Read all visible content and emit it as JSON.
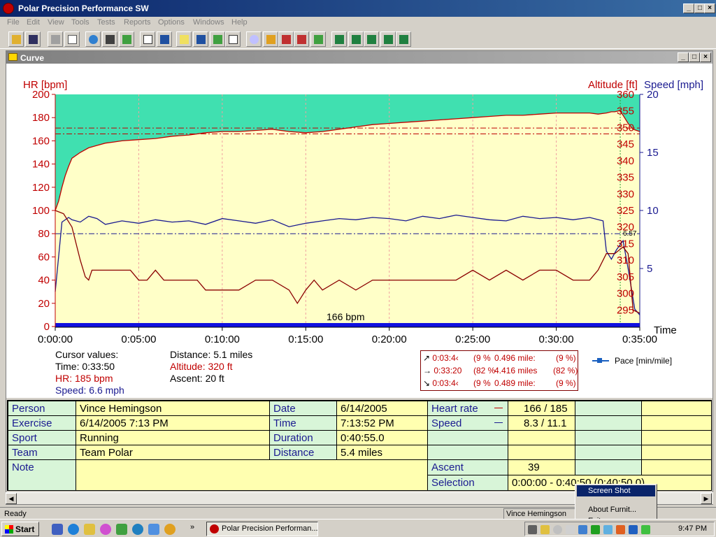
{
  "app": {
    "title": "Polar Precision Performance SW",
    "menu": [
      "File",
      "Edit",
      "View",
      "Tools",
      "Tests",
      "Reports",
      "Options",
      "Windows",
      "Help"
    ]
  },
  "child_window": {
    "title": "Curve"
  },
  "chart_data": {
    "type": "line",
    "xlabel": "Time",
    "x_ticks": [
      "0:00:00",
      "0:05:00",
      "0:10:00",
      "0:15:00",
      "0:20:00",
      "0:25:00",
      "0:30:00",
      "0:35:00"
    ],
    "xlim_minutes": [
      0,
      35
    ],
    "axes": {
      "left": {
        "label": "HR [bpm]",
        "color": "#c00000",
        "ylim": [
          0,
          200
        ],
        "ticks": [
          "0",
          "20",
          "40",
          "60",
          "80",
          "100",
          "120",
          "140",
          "160",
          "180",
          "200"
        ]
      },
      "right_altitude": {
        "label": "Altitude [ft]",
        "color": "#c00000",
        "ylim": [
          290,
          360
        ],
        "ticks": [
          "295",
          "300",
          "305",
          "310",
          "315",
          "320",
          "325",
          "330",
          "335",
          "340",
          "345",
          "350",
          "355",
          "360"
        ]
      },
      "right_speed": {
        "label": "Speed [mph]",
        "color": "#1a1a90",
        "ylim": [
          0,
          20
        ],
        "ticks": [
          "5",
          "10",
          "15",
          "20"
        ]
      }
    },
    "annotation": "166 bpm",
    "cursor_readout": "6.57",
    "reference_lines_hr": [
      166,
      171
    ],
    "reference_line_speed": 8,
    "cursor_minutes": 33.83,
    "series": [
      {
        "name": "HR",
        "axis": "left",
        "color": "#c00000",
        "x": [
          0,
          0.2,
          0.4,
          0.6,
          0.8,
          1,
          1.5,
          2,
          2.5,
          3,
          3.5,
          4,
          5,
          6,
          7,
          8,
          9,
          10,
          11,
          12,
          13,
          14,
          15,
          16,
          17,
          18,
          19,
          20,
          21,
          22,
          23,
          24,
          25,
          26,
          27,
          28,
          29,
          30,
          31,
          32,
          32.5,
          33,
          33.3,
          33.5,
          33.8,
          34,
          34.3,
          34.6,
          35
        ],
        "y": [
          100,
          108,
          120,
          130,
          138,
          145,
          150,
          154,
          156,
          158,
          159,
          160,
          161,
          162,
          164,
          165,
          167,
          168,
          168,
          169,
          170,
          168,
          167,
          168,
          170,
          172,
          174,
          175,
          176,
          177,
          178,
          179,
          180,
          181,
          182,
          182,
          183,
          184,
          184,
          184,
          183,
          184,
          185,
          185,
          186,
          182,
          175,
          170,
          168
        ]
      },
      {
        "name": "Speed",
        "axis": "right_speed",
        "color": "#1a1a90",
        "x": [
          0,
          0.2,
          0.4,
          0.8,
          1,
          1.5,
          2,
          2.5,
          3,
          4,
          5,
          6,
          7,
          8,
          9,
          10,
          11,
          12,
          13,
          14,
          15,
          16,
          17,
          18,
          19,
          20,
          21,
          22,
          23,
          24,
          25,
          26,
          27,
          28,
          29,
          30,
          31,
          32,
          32.8,
          33,
          33.3,
          33.6,
          34,
          34.3,
          34.7,
          35
        ],
        "y": [
          3,
          6,
          9,
          9.4,
          9.2,
          9,
          9.5,
          9.3,
          8.8,
          9.1,
          8.9,
          9.2,
          9,
          9.1,
          8.8,
          9.3,
          9.1,
          8.9,
          9.2,
          8.6,
          8.9,
          9.1,
          9.3,
          9.2,
          9.4,
          9.3,
          9.1,
          9.5,
          9.3,
          9.6,
          9.4,
          9.2,
          9.1,
          9.5,
          9.3,
          9.4,
          9.2,
          9.4,
          9.1,
          6.5,
          5.8,
          6.6,
          7.4,
          5,
          1.5,
          1
        ]
      },
      {
        "name": "Altitude",
        "axis": "right_altitude",
        "color": "#8b0000",
        "x": [
          0,
          0.5,
          1,
          1.5,
          1.8,
          2,
          2.2,
          2.5,
          4.5,
          5,
          5.5,
          6,
          6.5,
          8,
          8.5,
          9,
          10,
          11,
          12,
          13,
          14,
          14.5,
          15,
          15.5,
          16,
          17,
          18,
          19,
          20,
          22,
          23,
          24,
          25,
          26,
          27,
          28,
          29,
          30,
          31,
          32,
          32.5,
          33,
          33.5,
          34,
          34.3,
          34.6,
          35
        ],
        "y": [
          325,
          324,
          320,
          310,
          305,
          304,
          307,
          307,
          307,
          304,
          304,
          307,
          304,
          304,
          304,
          301,
          301,
          301,
          304,
          304,
          301,
          297,
          301,
          304,
          301,
          304,
          301,
          304,
          304,
          304,
          304,
          304,
          307,
          304,
          307,
          304,
          307,
          307,
          304,
          304,
          307,
          312,
          312,
          314,
          312,
          295,
          294
        ]
      }
    ]
  },
  "cursor_values": {
    "heading": "Cursor values:",
    "time": "Time: 0:33:50",
    "hr": "HR: 185 bpm",
    "speed": "Speed: 6.6 mph",
    "distance": "Distance: 5.1 miles",
    "altitude": "Altitude: 320 ft",
    "ascent": "Ascent: 20 ft"
  },
  "lap_box": {
    "rows": [
      {
        "icon": "↗",
        "time": "0:03:4‹",
        "pct": "(9 %",
        "dist": "0.496 mile:",
        "pct2": "(9 %)"
      },
      {
        "icon": "→",
        "time": "0:33:20",
        "pct": "(82 %",
        "dist": "4.416 miles",
        "pct2": "(82 %)"
      },
      {
        "icon": "↘",
        "time": "0:03:4‹",
        "pct": "(9 %",
        "dist": "0.489 mile:",
        "pct2": "(9 %)"
      }
    ]
  },
  "legend": {
    "pace": "Pace [min/mile]"
  },
  "info": {
    "person_label": "Person",
    "person": "Vince Hemingson",
    "exercise_label": "Exercise",
    "exercise": "6/14/2005 7:13 PM",
    "sport_label": "Sport",
    "sport": "Running",
    "team_label": "Team",
    "team": "Team Polar",
    "note_label": "Note",
    "date_label": "Date",
    "date": "6/14/2005",
    "time_label": "Time",
    "time": "7:13:52 PM",
    "duration_label": "Duration",
    "duration": "0:40:55.0",
    "distance_label": "Distance",
    "distance": "5.4 miles",
    "hr_label": "Heart rate",
    "hr": "166 / 185",
    "speed_label": "Speed",
    "speed": "8.3 / 11.1",
    "ascent_label": "Ascent",
    "ascent": "39",
    "selection_label": "Selection",
    "selection": "0:00:00 - 0:40:50 (0:40:50.0)"
  },
  "status": {
    "left": "Ready",
    "user": "Vince Hemingson"
  },
  "context_menu": {
    "items": [
      "Screen Shot",
      "About Furnit...",
      "Exit"
    ]
  },
  "taskbar": {
    "start": "Start",
    "task": "Polar Precision Performan...",
    "clock": "9:47 PM"
  }
}
